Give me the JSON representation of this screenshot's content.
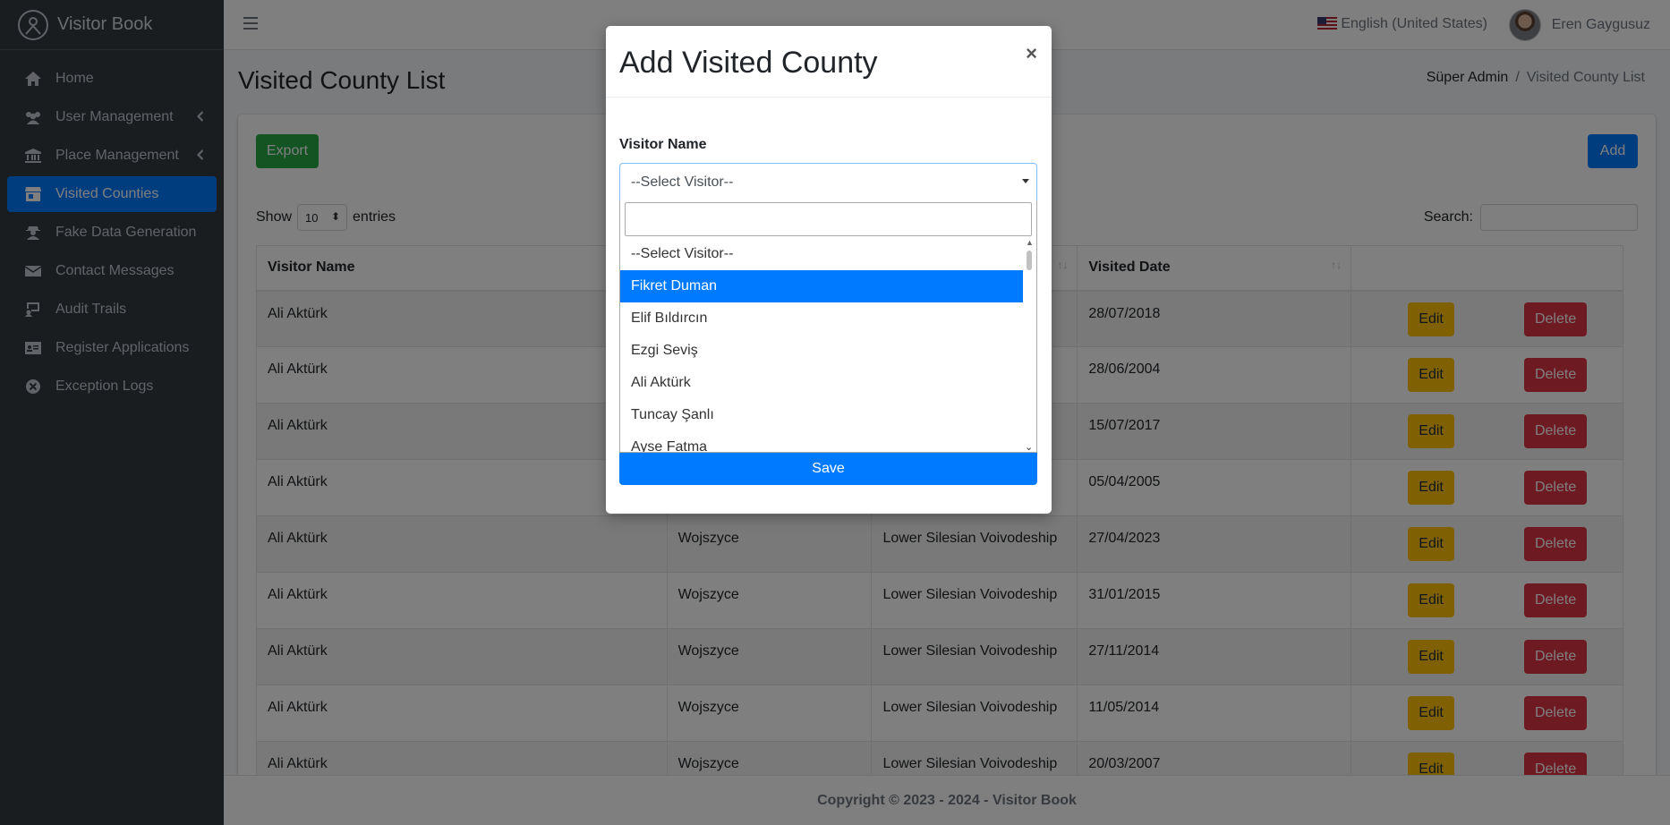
{
  "sidebar": {
    "brand": "Visitor Book",
    "items": [
      {
        "label": "Home",
        "icon": "home-icon"
      },
      {
        "label": "User Management",
        "icon": "users-icon",
        "has_arrow": true
      },
      {
        "label": "Place Management",
        "icon": "landmark-icon",
        "has_arrow": true
      },
      {
        "label": "Visited Counties",
        "icon": "store-icon",
        "active": true
      },
      {
        "label": "Fake Data Generation",
        "icon": "user-secret-icon"
      },
      {
        "label": "Contact Messages",
        "icon": "envelope-icon"
      },
      {
        "label": "Audit Trails",
        "icon": "trail-icon"
      },
      {
        "label": "Register Applications",
        "icon": "id-card-icon"
      },
      {
        "label": "Exception Logs",
        "icon": "x-circle-icon"
      }
    ]
  },
  "header": {
    "language": "English (United States)",
    "user_name": "Eren Gaygusuz"
  },
  "page": {
    "title": "Visited County List",
    "breadcrumb": [
      "Süper Admin",
      "Visited County List"
    ],
    "export_label": "Export",
    "add_label": "Add",
    "show_label": "Show",
    "entries_value": "10",
    "entries_label": "entries",
    "search_label": "Search:"
  },
  "table": {
    "headers": [
      "Visitor Name",
      "",
      "",
      "Visited Date",
      ""
    ],
    "edit_label": "Edit",
    "delete_label": "Delete",
    "rows": [
      {
        "name": "Ali Aktürk",
        "county": "",
        "state": "",
        "date": "28/07/2018"
      },
      {
        "name": "Ali Aktürk",
        "county": "",
        "state": "",
        "date": "28/06/2004"
      },
      {
        "name": "Ali Aktürk",
        "county": "",
        "state": "",
        "date": "15/07/2017"
      },
      {
        "name": "Ali Aktürk",
        "county": "",
        "state": "",
        "date": "05/04/2005"
      },
      {
        "name": "Ali Aktürk",
        "county": "Wojszyce",
        "state": "Lower Silesian Voivodeship",
        "date": "27/04/2023"
      },
      {
        "name": "Ali Aktürk",
        "county": "Wojszyce",
        "state": "Lower Silesian Voivodeship",
        "date": "31/01/2015"
      },
      {
        "name": "Ali Aktürk",
        "county": "Wojszyce",
        "state": "Lower Silesian Voivodeship",
        "date": "27/11/2014"
      },
      {
        "name": "Ali Aktürk",
        "county": "Wojszyce",
        "state": "Lower Silesian Voivodeship",
        "date": "11/05/2014"
      },
      {
        "name": "Ali Aktürk",
        "county": "Wojszyce",
        "state": "Lower Silesian Voivodeship",
        "date": "20/03/2007"
      }
    ]
  },
  "footer": {
    "text": "Copyright © 2023 - 2024 - Visitor Book"
  },
  "modal": {
    "title": "Add Visited County",
    "close": "×",
    "field_label": "Visitor Name",
    "selected": "--Select Visitor--",
    "options": [
      "--Select Visitor--",
      "Fikret Duman",
      "Elif Bıldırcın",
      "Ezgi Seviş",
      "Ali Aktürk",
      "Tuncay Şanlı",
      "Ayse Fatma"
    ],
    "highlighted_index": 1,
    "save_label": "Save"
  },
  "colors": {
    "sidebar_bg": "#343a40",
    "primary": "#007bff",
    "success": "#28a745",
    "warning": "#ffc107",
    "danger": "#dc3545"
  }
}
